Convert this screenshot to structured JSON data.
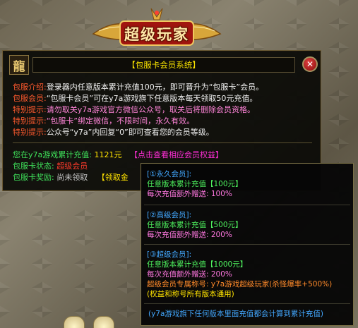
{
  "banner": {
    "title": "超级玩家"
  },
  "header": {
    "icon_glyph": "龍",
    "title": "【包服卡会员系统】",
    "close_glyph": "✕"
  },
  "info": [
    {
      "label": "包服介绍:",
      "text": "登录器内任意版本累计充值100元，即可晋升为“包服卡”会员。"
    },
    {
      "label": "包服会员:",
      "text": "“包服卡会员”可在y7a游戏旗下任意版本每天领取50元充值。"
    },
    {
      "label": "特别提示:",
      "text": "请勿取关y7a游戏官方微信公众号，取关后将删除会员资格。"
    },
    {
      "label": "特别提示:",
      "text": "“包服卡”绑定微信，不限时间，永久有效。"
    },
    {
      "label": "特别提示:",
      "text": "公众号“y7a”内回复“0”即可查看您的会员等级。"
    }
  ],
  "stats": {
    "total_label": "您在y7a游戏累计充值:",
    "total_value": "1121元",
    "benefits_link": "【点击查看相应会员权益】",
    "status_label": "包服卡状态:",
    "status_value": "超级会员",
    "reward_label": "包服卡奖励:",
    "reward_value": "尚未领取",
    "claim_button": "【领取金"
  },
  "tooltip": {
    "tier1": {
      "title": "[①永久会员]:",
      "line1": "任意版本累计充值【100元】",
      "line2": "每次充值额外赠送: 100%"
    },
    "tier2": {
      "title": "[②高级会员]:",
      "line1": "任意版本累计充值【500元】",
      "line2": "每次充值额外赠送: 200%"
    },
    "tier3": {
      "title": "[③超级会员]:",
      "line1": "任意版本累计充值【1000元】",
      "line2": "每次充值额外赠送: 200%",
      "line3": "超级会员专属称号: y7a游戏超级玩家(杀怪爆率+500%)",
      "line4": "(权益和称号所有版本通用)"
    },
    "footer": "(y7a游戏旗下任何版本里面充值都会计算到累计充值)"
  },
  "colors": {
    "label_red": "#ff5a2e",
    "yellow": "#ffe300",
    "green": "#3fe05a",
    "magenta": "#ff2ed6",
    "blue": "#43a8ff"
  }
}
